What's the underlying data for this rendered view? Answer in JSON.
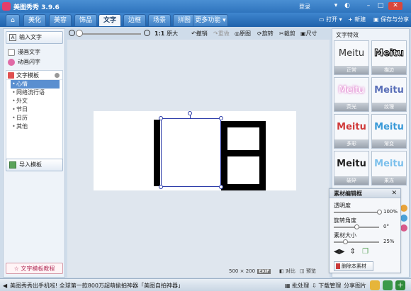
{
  "app": {
    "title": "美图秀秀 3.9.6",
    "login": "登录"
  },
  "window_controls": {
    "close": "✕"
  },
  "nav": {
    "tabs": [
      "美化",
      "美容",
      "饰品",
      "文字",
      "边框",
      "场景",
      "拼图",
      "更多功能"
    ],
    "active": "文字",
    "open": "打开",
    "new": "新建",
    "save": "保存与分享"
  },
  "left": {
    "input_text": "输入文字",
    "manhua": "漫画文字",
    "animation": "动画闪字",
    "template_title": "文字模板",
    "template_items": [
      "心情",
      "网络流行语",
      "外文",
      "节日",
      "日历",
      "其他"
    ],
    "import_template": "导入模板",
    "tutorial": "文字模板教程"
  },
  "toolbar": {
    "ratio": "1:1",
    "enlarge": "原大",
    "undo": "撤销",
    "redo": "重做",
    "original": "原图",
    "rotate": "旋转",
    "crop": "裁剪",
    "size": "尺寸"
  },
  "canvas": {
    "size_w": "500",
    "size_x": "×",
    "size_h": "200",
    "exif": "EXIF",
    "compare": "对比",
    "preview": "预览"
  },
  "right": {
    "title": "文字特效",
    "effects": [
      {
        "preview": "Meitu",
        "name": "正常"
      },
      {
        "preview": "Meitu",
        "name": "描边"
      },
      {
        "preview": "Meitu",
        "name": "荧光"
      },
      {
        "preview": "Meitu",
        "name": "纹理"
      },
      {
        "preview": "Meitu",
        "name": "多彩"
      },
      {
        "preview": "Meitu",
        "name": "渐变"
      },
      {
        "preview": "Meitu",
        "name": "破碎"
      },
      {
        "preview": "Meitu",
        "name": "果冻"
      }
    ]
  },
  "material": {
    "title": "素材编辑框",
    "opacity_label": "透明度",
    "opacity_value": "100%",
    "opacity": 1.0,
    "rotation_label": "旋转角度",
    "rotation_value": "0°",
    "rotation": 0.5,
    "size_label": "素材大小",
    "size_value": "25%",
    "size": 0.25,
    "delete": "删除本素材"
  },
  "bottom": {
    "ticker": "美图秀秀出手机啦! 全球第一款800万超萌偷拍神器「美图自拍神器」",
    "batch": "批处理",
    "download": "下载管理",
    "share": "分享图片"
  },
  "colors": {
    "accent": "#2f74bd",
    "selection": "#2a3aa8"
  }
}
